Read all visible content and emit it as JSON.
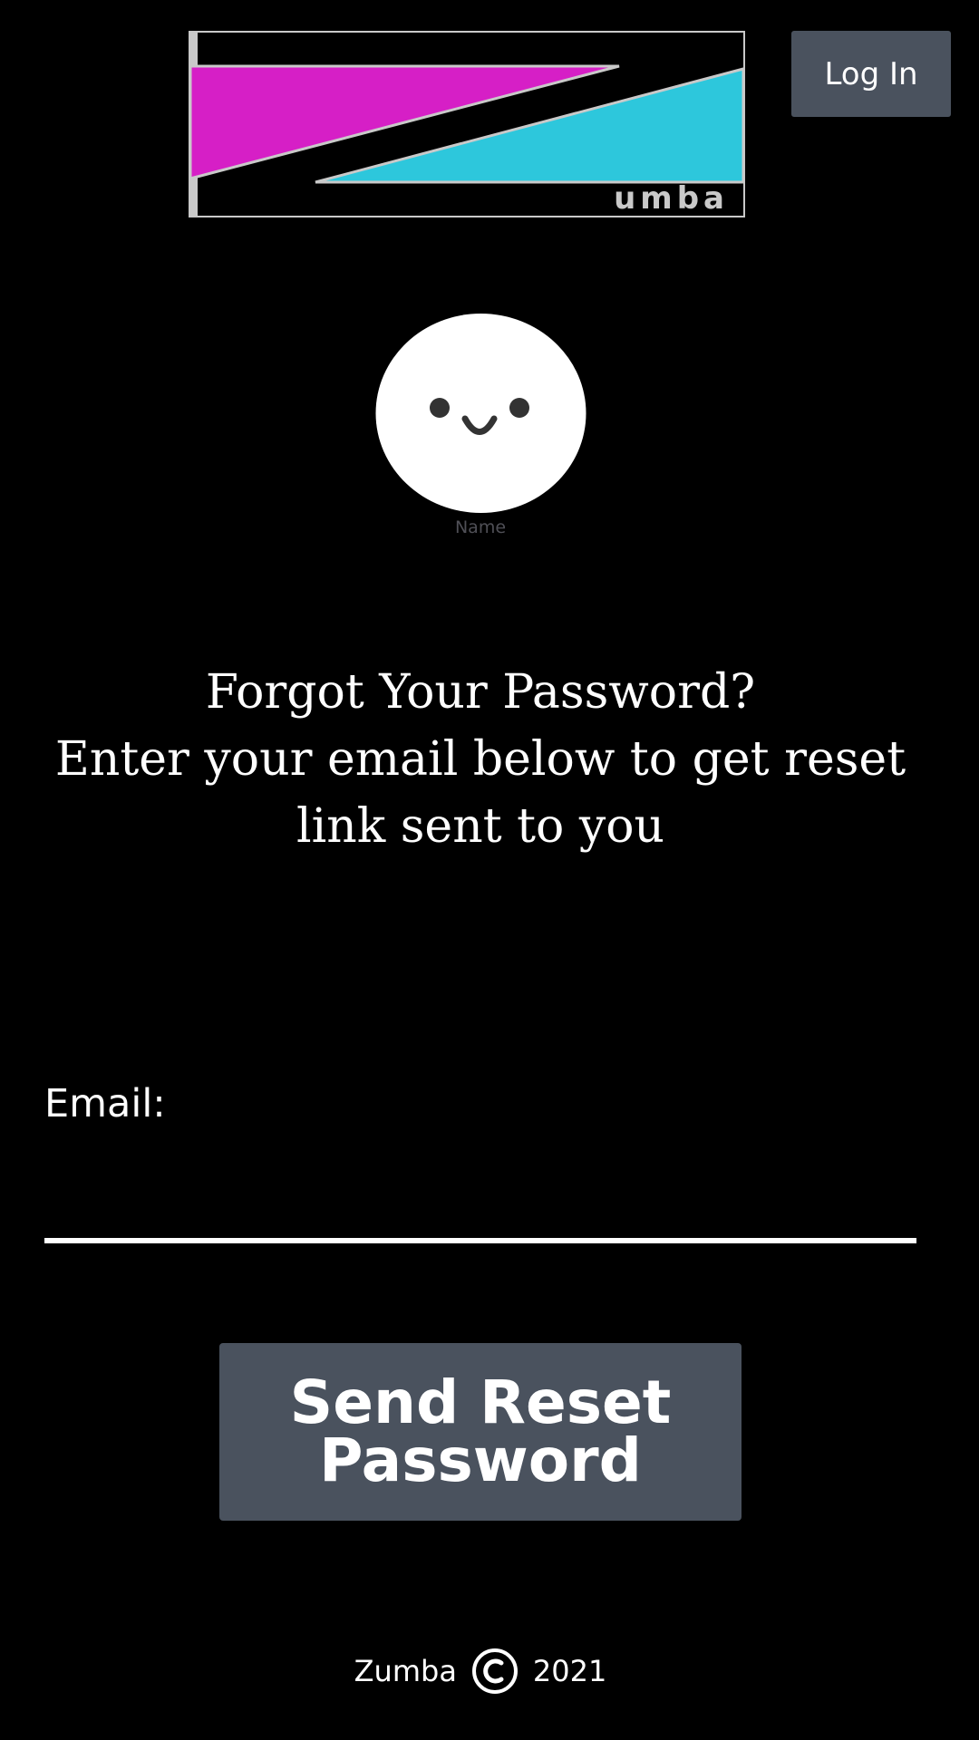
{
  "header": {
    "logo_text": "umba",
    "login_label": "Log In"
  },
  "profile": {
    "name_label": "Name"
  },
  "main": {
    "heading_line1": "Forgot Your Password?",
    "heading_line2": "Enter your email below to get reset link sent to you",
    "email_label": "Email:",
    "email_value": "",
    "send_label_line1": "Send Reset",
    "send_label_line2": "Password"
  },
  "footer": {
    "brand": "Zumba",
    "year": "2021",
    "copyright_icon": "copyright-icon"
  },
  "colors": {
    "background": "#000000",
    "button": "#4a525e",
    "logo_magenta": "#d61fc6",
    "logo_cyan": "#2dc7dc",
    "text": "#ffffff"
  }
}
